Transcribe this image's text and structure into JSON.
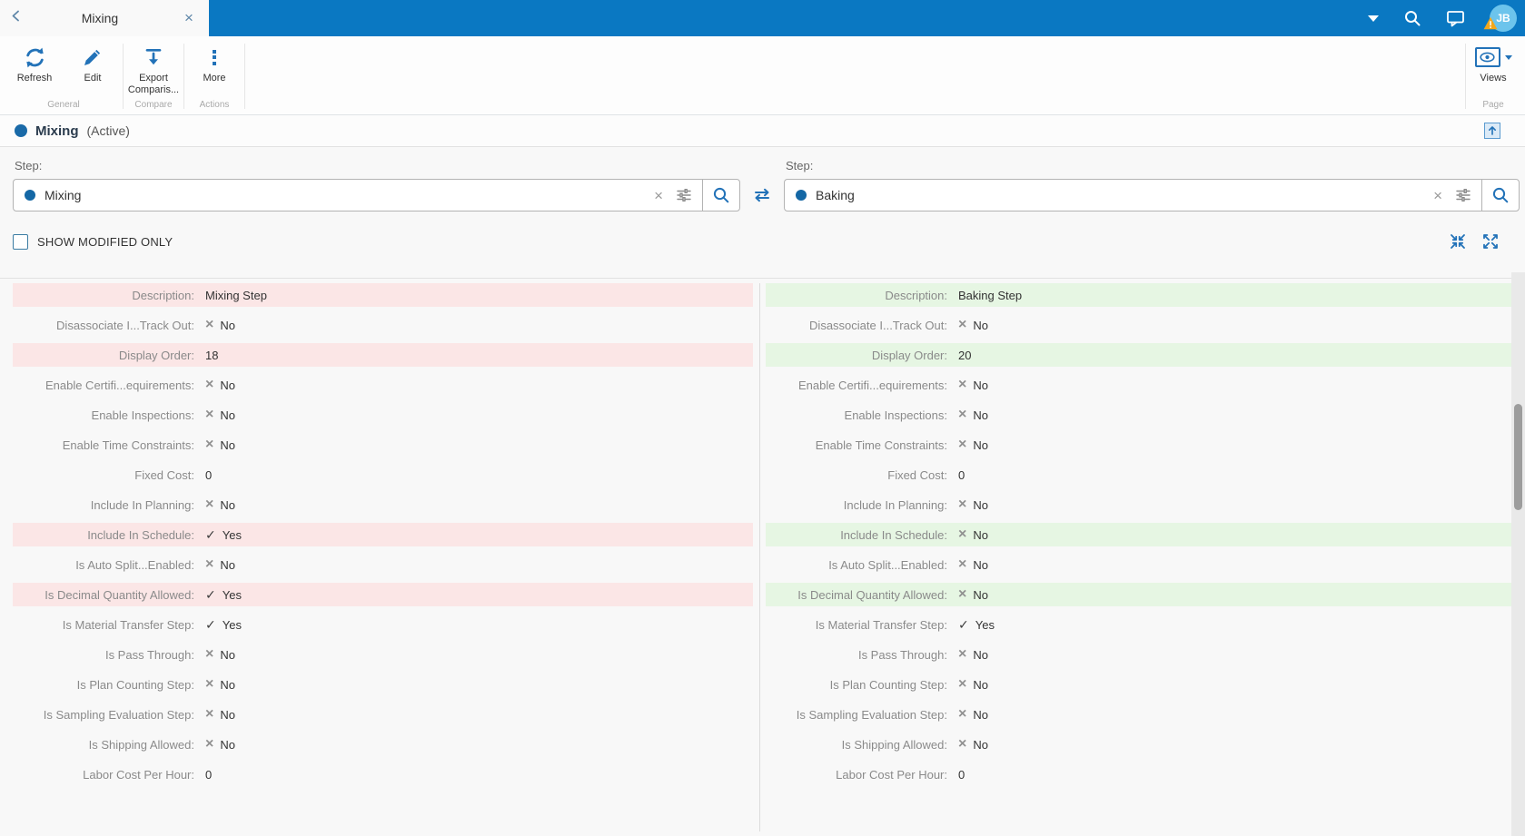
{
  "window": {
    "tab_title": "Mixing",
    "avatar_initials": "JB"
  },
  "toolbar": {
    "refresh_label": "Refresh",
    "edit_label": "Edit",
    "export_label": "Export Comparis...",
    "more_label": "More",
    "group_general": "General",
    "group_compare": "Compare",
    "group_actions": "Actions",
    "views_label": "Views",
    "group_page": "Page"
  },
  "entity": {
    "name": "Mixing",
    "status": "(Active)"
  },
  "selectors": {
    "left": {
      "label": "Step:",
      "value": "Mixing"
    },
    "right": {
      "label": "Step:",
      "value": "Baking"
    }
  },
  "controls": {
    "show_modified_label": "SHOW MODIFIED ONLY"
  },
  "glyphs": {
    "cross": "×",
    "check": "✓"
  },
  "colors": {
    "header_blue": "#0a78c2",
    "icon_blue": "#2272b8",
    "diff_left_bg": "#fbe6e6",
    "diff_right_bg": "#e6f6e3"
  },
  "comparison": {
    "rows": [
      {
        "label": "Description:",
        "left": {
          "value": "Mixing Step",
          "icon": "none",
          "diff": true
        },
        "right": {
          "value": "Baking Step",
          "icon": "none",
          "diff": true
        }
      },
      {
        "label": "Disassociate I...Track Out:",
        "left": {
          "value": "No",
          "icon": "cross",
          "diff": false
        },
        "right": {
          "value": "No",
          "icon": "cross",
          "diff": false
        }
      },
      {
        "label": "Display Order:",
        "left": {
          "value": "18",
          "icon": "none",
          "diff": true
        },
        "right": {
          "value": "20",
          "icon": "none",
          "diff": true
        }
      },
      {
        "label": "Enable Certifi...equirements:",
        "left": {
          "value": "No",
          "icon": "cross",
          "diff": false
        },
        "right": {
          "value": "No",
          "icon": "cross",
          "diff": false
        }
      },
      {
        "label": "Enable Inspections:",
        "left": {
          "value": "No",
          "icon": "cross",
          "diff": false
        },
        "right": {
          "value": "No",
          "icon": "cross",
          "diff": false
        }
      },
      {
        "label": "Enable Time Constraints:",
        "left": {
          "value": "No",
          "icon": "cross",
          "diff": false
        },
        "right": {
          "value": "No",
          "icon": "cross",
          "diff": false
        }
      },
      {
        "label": "Fixed Cost:",
        "left": {
          "value": "0",
          "icon": "none",
          "diff": false
        },
        "right": {
          "value": "0",
          "icon": "none",
          "diff": false
        }
      },
      {
        "label": "Include In Planning:",
        "left": {
          "value": "No",
          "icon": "cross",
          "diff": false
        },
        "right": {
          "value": "No",
          "icon": "cross",
          "diff": false
        }
      },
      {
        "label": "Include In Schedule:",
        "left": {
          "value": "Yes",
          "icon": "check",
          "diff": true
        },
        "right": {
          "value": "No",
          "icon": "cross",
          "diff": true
        }
      },
      {
        "label": "Is Auto Split...Enabled:",
        "left": {
          "value": "No",
          "icon": "cross",
          "diff": false
        },
        "right": {
          "value": "No",
          "icon": "cross",
          "diff": false
        }
      },
      {
        "label": "Is Decimal Quantity Allowed:",
        "left": {
          "value": "Yes",
          "icon": "check",
          "diff": true
        },
        "right": {
          "value": "No",
          "icon": "cross",
          "diff": true
        }
      },
      {
        "label": "Is Material Transfer Step:",
        "left": {
          "value": "Yes",
          "icon": "check",
          "diff": false
        },
        "right": {
          "value": "Yes",
          "icon": "check",
          "diff": false
        }
      },
      {
        "label": "Is Pass Through:",
        "left": {
          "value": "No",
          "icon": "cross",
          "diff": false
        },
        "right": {
          "value": "No",
          "icon": "cross",
          "diff": false
        }
      },
      {
        "label": "Is Plan Counting Step:",
        "left": {
          "value": "No",
          "icon": "cross",
          "diff": false
        },
        "right": {
          "value": "No",
          "icon": "cross",
          "diff": false
        }
      },
      {
        "label": "Is Sampling Evaluation Step:",
        "left": {
          "value": "No",
          "icon": "cross",
          "diff": false
        },
        "right": {
          "value": "No",
          "icon": "cross",
          "diff": false
        }
      },
      {
        "label": "Is Shipping Allowed:",
        "left": {
          "value": "No",
          "icon": "cross",
          "diff": false
        },
        "right": {
          "value": "No",
          "icon": "cross",
          "diff": false
        }
      },
      {
        "label": "Labor Cost Per Hour:",
        "left": {
          "value": "0",
          "icon": "none",
          "diff": false
        },
        "right": {
          "value": "0",
          "icon": "none",
          "diff": false
        }
      }
    ]
  }
}
